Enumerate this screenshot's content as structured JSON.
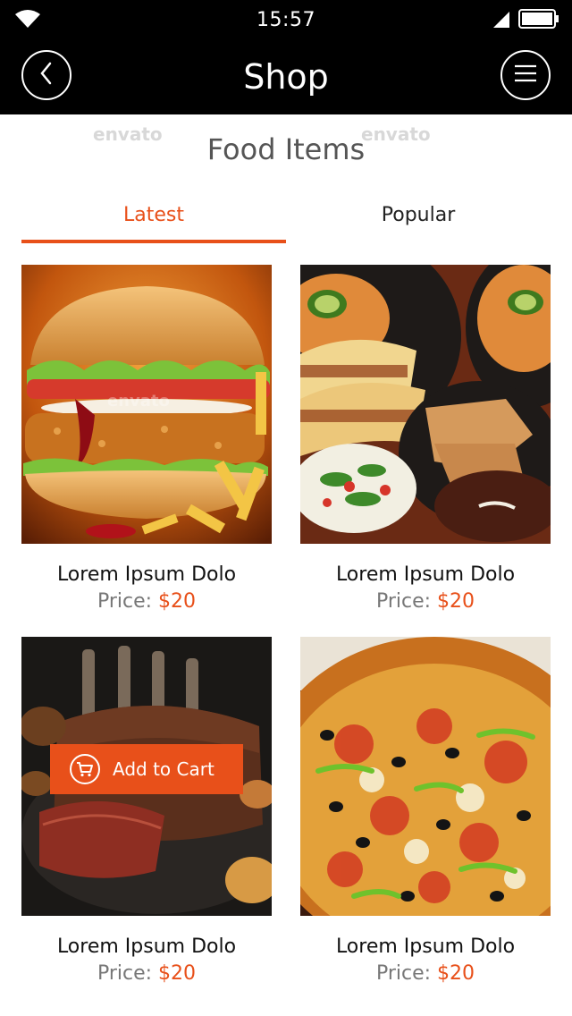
{
  "status": {
    "time": "15:57"
  },
  "nav": {
    "title": "Shop"
  },
  "page": {
    "section_title": "Food Items"
  },
  "tabs": [
    {
      "label": "Latest",
      "active": true
    },
    {
      "label": "Popular",
      "active": false
    }
  ],
  "items": [
    {
      "name": "Lorem Ipsum Dolo",
      "price_label": "Price:",
      "price": "$20",
      "image": "burger"
    },
    {
      "name": "Lorem Ipsum Dolo",
      "price_label": "Price:",
      "price": "$20",
      "image": "tacos"
    },
    {
      "name": "Lorem Ipsum Dolo",
      "price_label": "Price:",
      "price": "$20",
      "image": "roast"
    },
    {
      "name": "Lorem Ipsum Dolo",
      "price_label": "Price:",
      "price": "$20",
      "image": "pizza"
    }
  ],
  "cart_button": {
    "label": "Add to Cart"
  },
  "watermark": "envato",
  "colors": {
    "accent": "#e8501a",
    "bar": "#000000"
  }
}
